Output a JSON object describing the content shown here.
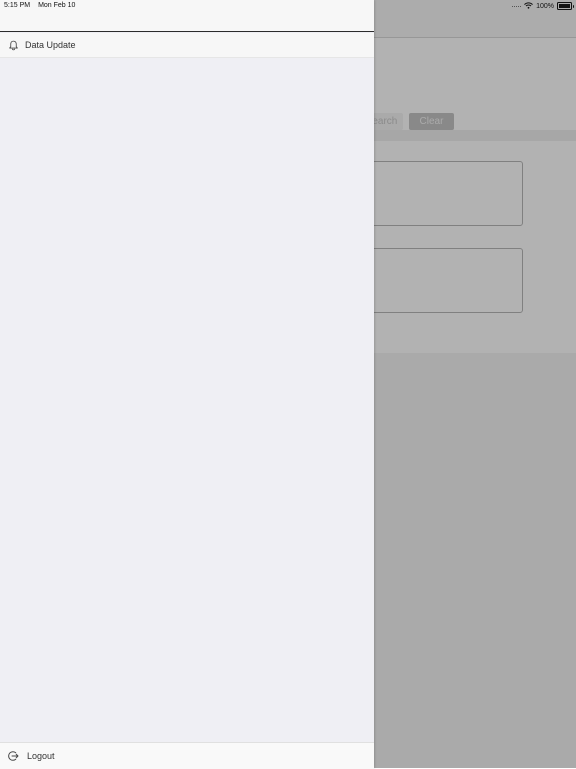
{
  "status_bar": {
    "time": "5:15 PM",
    "date": "Mon Feb 10",
    "battery_percent": "100%"
  },
  "background_page": {
    "search_button_label": "Search",
    "clear_button_label": "Clear"
  },
  "drawer": {
    "menu_items": [
      {
        "label": "Data Update",
        "icon": "bell-icon"
      }
    ],
    "footer": {
      "label": "Logout",
      "icon": "logout-icon"
    }
  },
  "colors": {
    "drawer_bg": "#efeff4",
    "scrim": "rgba(0,0,0,0.30)"
  }
}
